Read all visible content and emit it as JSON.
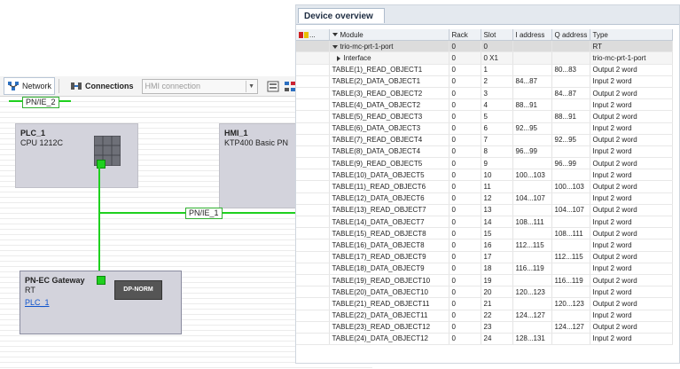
{
  "network": {
    "toolbar": {
      "network_label": "Network",
      "connections_label": "Connections",
      "connection_select_value": "HMI connection"
    },
    "bus_top_label": "PN/IE_2",
    "bus_mid_label": "PN/IE_1",
    "devices": {
      "plc": {
        "title": "PLC_1",
        "subtitle": "CPU 1212C"
      },
      "hmi": {
        "title": "HMI_1",
        "subtitle": "KTP400 Basic PN"
      },
      "gateway": {
        "title": "PN-EC Gateway",
        "subtitle": "RT",
        "link": "PLC_1",
        "module_label": "DP-NORM"
      }
    }
  },
  "overview": {
    "tab_label": "Device overview",
    "columns": [
      "Module",
      "Rack",
      "Slot",
      "I address",
      "Q address",
      "Type"
    ],
    "rows": [
      {
        "module": "trio-mc-prt-1-port",
        "rack": "0",
        "slot": "0",
        "i": "",
        "q": "",
        "type": "RT"
      },
      {
        "module": "Interface",
        "rack": "0",
        "slot": "0 X1",
        "i": "",
        "q": "",
        "type": "trio-mc-prt-1-port"
      },
      {
        "module": "TABLE(1)_READ_OBJECT1",
        "rack": "0",
        "slot": "1",
        "i": "",
        "q": "80...83",
        "type": "Output 2 word"
      },
      {
        "module": "TABLE(2)_DATA_OBJECT1",
        "rack": "0",
        "slot": "2",
        "i": "84...87",
        "q": "",
        "type": "Input 2 word"
      },
      {
        "module": "TABLE(3)_READ_OBJECT2",
        "rack": "0",
        "slot": "3",
        "i": "",
        "q": "84...87",
        "type": "Output 2 word"
      },
      {
        "module": "TABLE(4)_DATA_OBJECT2",
        "rack": "0",
        "slot": "4",
        "i": "88...91",
        "q": "",
        "type": "Input 2 word"
      },
      {
        "module": "TABLE(5)_READ_OBJECT3",
        "rack": "0",
        "slot": "5",
        "i": "",
        "q": "88...91",
        "type": "Output 2 word"
      },
      {
        "module": "TABLE(6)_DATA_OBJECT3",
        "rack": "0",
        "slot": "6",
        "i": "92...95",
        "q": "",
        "type": "Input 2 word"
      },
      {
        "module": "TABLE(7)_READ_OBJECT4",
        "rack": "0",
        "slot": "7",
        "i": "",
        "q": "92...95",
        "type": "Output 2 word"
      },
      {
        "module": "TABLE(8)_DATA_OBJECT4",
        "rack": "0",
        "slot": "8",
        "i": "96...99",
        "q": "",
        "type": "Input 2 word"
      },
      {
        "module": "TABLE(9)_READ_OBJECT5",
        "rack": "0",
        "slot": "9",
        "i": "",
        "q": "96...99",
        "type": "Output 2 word"
      },
      {
        "module": "TABLE(10)_DATA_OBJECT5",
        "rack": "0",
        "slot": "10",
        "i": "100...103",
        "q": "",
        "type": "Input 2 word"
      },
      {
        "module": "TABLE(11)_READ_OBJECT6",
        "rack": "0",
        "slot": "11",
        "i": "",
        "q": "100...103",
        "type": "Output 2 word"
      },
      {
        "module": "TABLE(12)_DATA_OBJECT6",
        "rack": "0",
        "slot": "12",
        "i": "104...107",
        "q": "",
        "type": "Input 2 word"
      },
      {
        "module": "TABLE(13)_READ_OBJECT7",
        "rack": "0",
        "slot": "13",
        "i": "",
        "q": "104...107",
        "type": "Output 2 word"
      },
      {
        "module": "TABLE(14)_DATA_OBJECT7",
        "rack": "0",
        "slot": "14",
        "i": "108...111",
        "q": "",
        "type": "Input 2 word"
      },
      {
        "module": "TABLE(15)_READ_OBJECT8",
        "rack": "0",
        "slot": "15",
        "i": "",
        "q": "108...111",
        "type": "Output 2 word"
      },
      {
        "module": "TABLE(16)_DATA_OBJECT8",
        "rack": "0",
        "slot": "16",
        "i": "112...115",
        "q": "",
        "type": "Input 2 word"
      },
      {
        "module": "TABLE(17)_READ_OBJECT9",
        "rack": "0",
        "slot": "17",
        "i": "",
        "q": "112...115",
        "type": "Output 2 word"
      },
      {
        "module": "TABLE(18)_DATA_OBJECT9",
        "rack": "0",
        "slot": "18",
        "i": "116...119",
        "q": "",
        "type": "Input 2 word"
      },
      {
        "module": "TABLE(19)_READ_OBJECT10",
        "rack": "0",
        "slot": "19",
        "i": "",
        "q": "116...119",
        "type": "Output 2 word"
      },
      {
        "module": "TABLE(20)_DATA_OBJECT10",
        "rack": "0",
        "slot": "20",
        "i": "120...123",
        "q": "",
        "type": "Input 2 word"
      },
      {
        "module": "TABLE(21)_READ_OBJECT11",
        "rack": "0",
        "slot": "21",
        "i": "",
        "q": "120...123",
        "type": "Output 2 word"
      },
      {
        "module": "TABLE(22)_DATA_OBJECT11",
        "rack": "0",
        "slot": "22",
        "i": "124...127",
        "q": "",
        "type": "Input 2 word"
      },
      {
        "module": "TABLE(23)_READ_OBJECT12",
        "rack": "0",
        "slot": "23",
        "i": "",
        "q": "124...127",
        "type": "Output 2 word"
      },
      {
        "module": "TABLE(24)_DATA_OBJECT12",
        "rack": "0",
        "slot": "24",
        "i": "128...131",
        "q": "",
        "type": "Input 2 word"
      }
    ]
  }
}
